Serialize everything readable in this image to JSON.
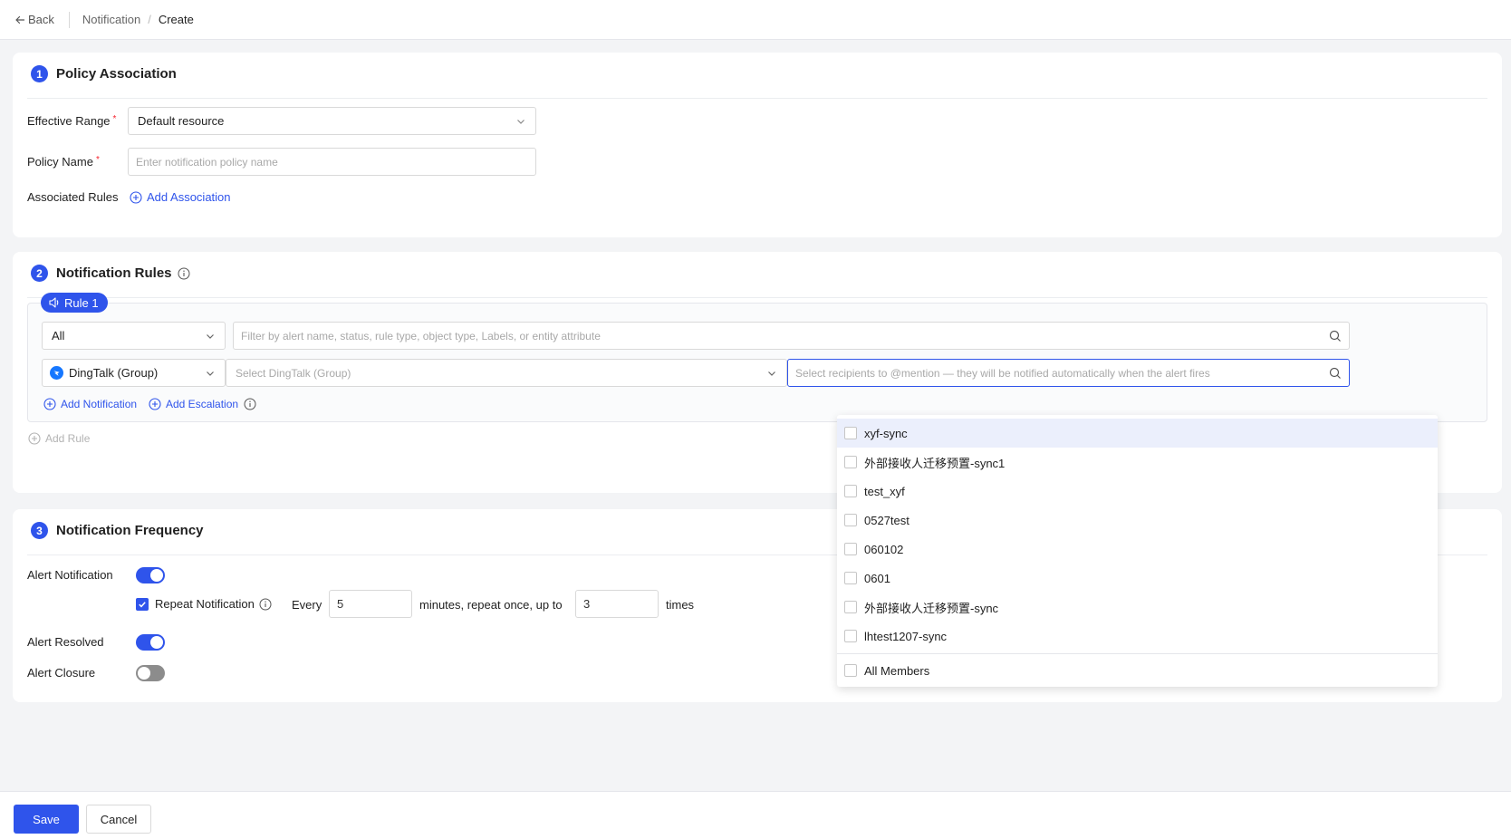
{
  "topbar": {
    "back_label": "Back",
    "breadcrumb": [
      "Notification",
      "Create"
    ]
  },
  "policy": {
    "step": "1",
    "title": "Policy Association",
    "effective_range_label": "Effective Range",
    "effective_range_value": "Default resource",
    "policy_name_label": "Policy Name",
    "policy_name_placeholder": "Enter notification policy name",
    "associated_rules_label": "Associated Rules",
    "add_association_label": "Add Association"
  },
  "rules": {
    "step": "2",
    "title": "Notification Rules",
    "rule_tag": "Rule 1",
    "scope_value": "All",
    "filter_placeholder": "Filter by alert name, status, rule type, object type, Labels, or entity attribute",
    "channel_value": "DingTalk (Group)",
    "channel_target_placeholder": "Select DingTalk (Group)",
    "mention_placeholder": "Select recipients to @mention — they will be notified automatically when the alert fires",
    "add_notification_label": "Add Notification",
    "add_escalation_label": "Add Escalation",
    "add_rule_label": "Add Rule"
  },
  "frequency": {
    "step": "3",
    "title": "Notification Frequency",
    "alert_notification_label": "Alert Notification",
    "alert_notification_on": true,
    "repeat_label": "Repeat Notification",
    "repeat_checked": true,
    "every_label": "Every",
    "every_value": "5",
    "minutes_label": "minutes, repeat once, up to",
    "times_value": "3",
    "times_label": "times",
    "alert_resolved_label": "Alert Resolved",
    "alert_resolved_on": true,
    "alert_closure_label": "Alert Closure",
    "alert_closure_on": false
  },
  "dropdown": {
    "options": [
      "xyf-sync",
      "外部接收人迁移预置-sync1",
      "test_xyf",
      "0527test",
      "060102",
      "0601",
      "外部接收人迁移预置-sync",
      "lhtest1207-sync"
    ],
    "all_members_label": "All Members"
  },
  "footer": {
    "save_label": "Save",
    "cancel_label": "Cancel"
  },
  "colors": {
    "primary": "#2f54eb",
    "required": "#f5222d",
    "toggle_off": "#8c8c8c",
    "dingtalk": "#1677ff"
  }
}
